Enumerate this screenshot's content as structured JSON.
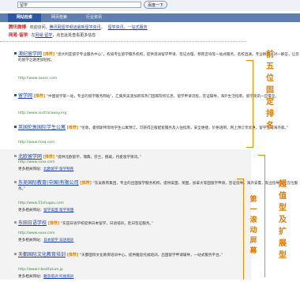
{
  "search": {
    "value": "留学",
    "button_label": "百度一下"
  },
  "tabs": [
    {
      "label": "网站检索"
    },
    {
      "label": "网页检索"
    },
    {
      "label": "行业资讯"
    }
  ],
  "ads": [
    {
      "logo": "腾讯微博",
      "text_a": "欢迎访问，",
      "link_a": "腾讯网留学频道最新留学资讯",
      "text_b": "，",
      "link_b": "留学资讯，一站式服务"
    },
    {
      "logo": "网易·留学",
      "text_a": "在",
      "link_a": "网易·留学",
      "text_b": "，点击此处查看更多信息",
      "link_b": ""
    }
  ],
  "results": [
    {
      "title": "澳纪留学网",
      "tag": "[推荐]",
      "desc": "“澳大利亚留学专业服务中心”，权威专业留学服务机构，提供澳洲留学申请、签证办理、移民咨询等一站式服务，名校直通，专业顾问一对一解答，让您的留学之路更加轻松。",
      "url": "http://www.aaoec.com"
    },
    {
      "title": "留学网",
      "tag": "[推荐]",
      "desc": "“中国留学第一站，专业的留学服务网站”，汇集英美澳加新等热门国家院校信息，留学申请流程，签证辅导，海外生活指南，留学资讯一应俱全。",
      "url": "http://www.australiaway.org"
    },
    {
      "title": "英国伦敦国际学生公寓",
      "tag": "[推荐]",
      "desc": "“伦敦，曼彻斯特等地学生公寓预订。可获得正版配套服务及入住指南，安全便捷，价格透明，网上预订享优惠，留学生的海外家。”",
      "url": "http://www.ilsaq.com"
    },
    {
      "title": "北欧留学网",
      "tag": "[推荐]",
      "desc": "“提供北欧留学，瑞典，芬兰，挪威，丹麦留学资讯。”",
      "url": "http://www.xxxx.com",
      "more": "更多相关网站：",
      "more_link": "北欧留学 留学移民"
    },
    {
      "title": "东吴国际教育(中国)有限公司",
      "tag": "[推荐]",
      "desc": "“东吴教育集团，专业的出国留学服务机构，提供美国，英国，加拿大等国留学申请，签证指导，海外安置，就业指导等全方位服务。”",
      "url": "http://www.51chugou.com",
      "more": "更多相关网站：",
      "more_link": "留学美国 留学英国"
    },
    {
      "title": "东田日语学校",
      "tag": "[推荐]",
      "desc": "“东田日语学校提供日本留学，日语培训，赴日签证服务。”",
      "url": "http://www.xxxx.com",
      "more": "更多相关网站：",
      "more_link": "日本留学 日语培训"
    },
    {
      "title": "天都国际文化教育培训",
      "tag": "[推荐]",
      "desc": "“天都国际文化教育培训中心，提供雅思托福培训，出国留学申请辅导，一站式服务平台。”",
      "url": "http://www.t-bestfuture.jp",
      "more": "更多相关网站：",
      "more_link": "雅思培训 托福培训"
    }
  ],
  "annotations": {
    "fixed": [
      "前",
      "五",
      "位",
      "固",
      "定",
      "排",
      "名"
    ],
    "rolling": [
      "第",
      "一",
      "滚",
      "动",
      "屏",
      "幕"
    ],
    "super": [
      "超",
      "值",
      "型",
      "及",
      "扩",
      "展",
      "型"
    ]
  },
  "colors": {
    "accent": "#2b56a3",
    "tab_bar": "#5f7fb0",
    "annotation": "#e27a00",
    "link": "#1a3fb5"
  }
}
